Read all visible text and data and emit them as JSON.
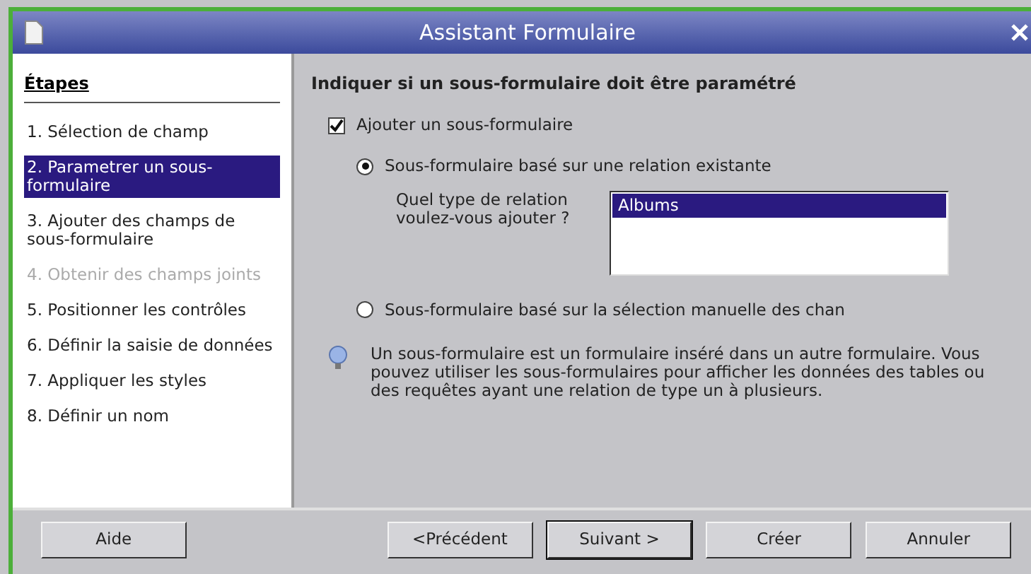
{
  "window": {
    "title": "Assistant Formulaire"
  },
  "sidebar": {
    "title": "Étapes",
    "items": [
      {
        "label": "1. Sélection de champ",
        "selected": false,
        "disabled": false
      },
      {
        "label": "2. Parametrer un sous-formulaire",
        "selected": true,
        "disabled": false
      },
      {
        "label": "3. Ajouter des champs de sous-formulaire",
        "selected": false,
        "disabled": false
      },
      {
        "label": "4. Obtenir des champs joints",
        "selected": false,
        "disabled": true
      },
      {
        "label": "5. Positionner les contrôles",
        "selected": false,
        "disabled": false
      },
      {
        "label": "6. Définir la saisie de données",
        "selected": false,
        "disabled": false
      },
      {
        "label": "7. Appliquer les styles",
        "selected": false,
        "disabled": false
      },
      {
        "label": "8. Définir un nom",
        "selected": false,
        "disabled": false
      }
    ]
  },
  "main": {
    "heading": "Indiquer si un sous-formulaire doit être paramétré",
    "checkbox": {
      "label": "Ajouter un sous-formulaire",
      "checked": true
    },
    "options": [
      {
        "label": "Sous-formulaire basé sur une relation existante",
        "selected": true
      },
      {
        "label": "Sous-formulaire basé sur la sélection manuelle des chan",
        "selected": false
      }
    ],
    "relation_label": "Quel type de relation voulez-vous ajouter ?",
    "relations": [
      {
        "label": "Albums",
        "selected": true
      }
    ],
    "info": "Un sous-formulaire est un formulaire inséré dans un autre formulaire. Vous pouvez utiliser les sous-formulaires pour afficher les données des tables ou des requêtes ayant une relation de type un à plusieurs."
  },
  "buttons": [
    {
      "label": "Aide",
      "default": false
    },
    {
      "label": "<Précédent",
      "default": false
    },
    {
      "label": "Suivant >",
      "default": true
    },
    {
      "label": "Créer",
      "default": false
    },
    {
      "label": "Annuler",
      "default": false
    }
  ]
}
